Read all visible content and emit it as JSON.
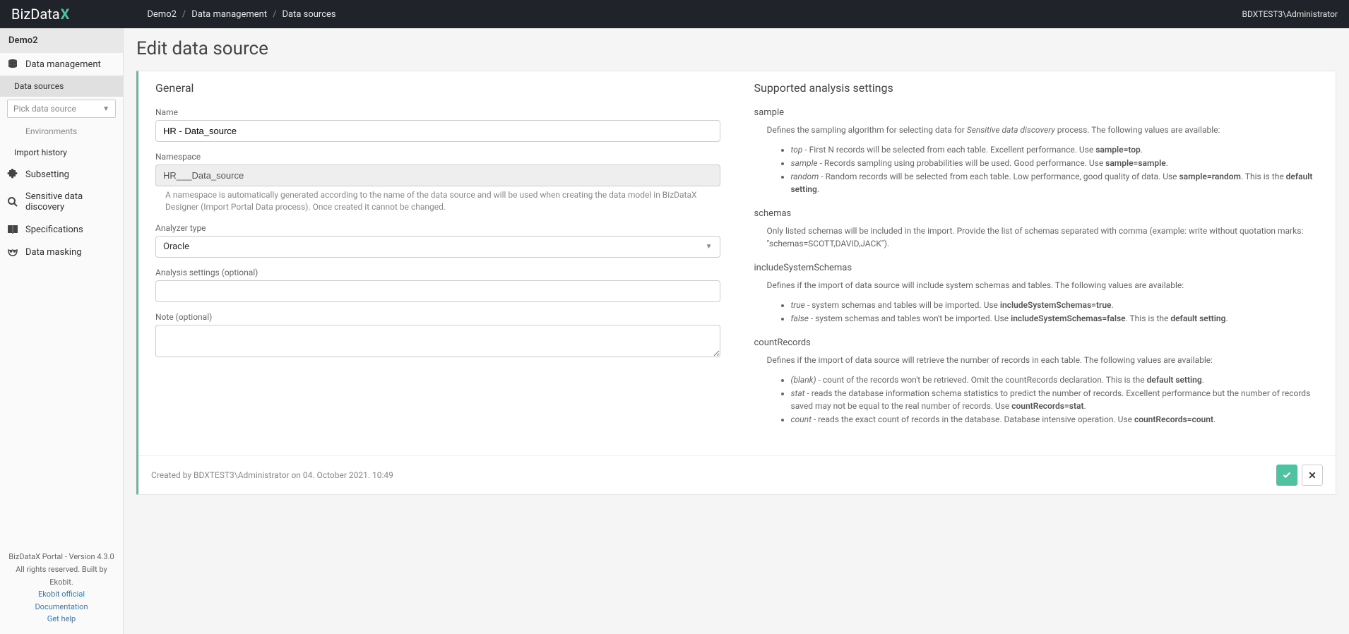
{
  "header": {
    "logo_text": "BizData",
    "logo_accent": "X",
    "breadcrumb": [
      "Demo2",
      "Data management",
      "Data sources"
    ],
    "user": "BDXTEST3\\Administrator"
  },
  "sidebar": {
    "title": "Demo2",
    "items": [
      {
        "label": "Data management",
        "icon": "database-icon"
      },
      {
        "label": "Subsetting",
        "icon": "puzzle-icon"
      },
      {
        "label": "Sensitive data discovery",
        "icon": "search-icon"
      },
      {
        "label": "Specifications",
        "icon": "book-icon"
      },
      {
        "label": "Data masking",
        "icon": "mask-icon"
      }
    ],
    "subitems": {
      "data_sources": "Data sources",
      "pick_placeholder": "Pick data source",
      "environments": "Environments",
      "import_history": "Import history"
    },
    "footer": {
      "version": "BizDataX Portal - Version 4.3.0",
      "rights": "All rights reserved. Built by Ekobit.",
      "links": [
        "Ekobit official",
        "Documentation",
        "Get help"
      ]
    }
  },
  "page": {
    "title": "Edit data source",
    "general": {
      "heading": "General",
      "name_label": "Name",
      "name_value": "HR - Data_source",
      "namespace_label": "Namespace",
      "namespace_value": "HR___Data_source",
      "namespace_help": "A namespace is automatically generated according to the name of the data source and will be used when creating the data model in BizDataX Designer (Import Portal Data process). Once created it cannot be changed.",
      "analyzer_label": "Analyzer type",
      "analyzer_value": "Oracle",
      "analysis_label": "Analysis settings (optional)",
      "analysis_value": "",
      "note_label": "Note (optional)",
      "note_value": ""
    },
    "settings": {
      "heading": "Supported analysis settings",
      "sample": {
        "key": "sample",
        "desc_prefix": "Defines the sampling algorithm for selecting data for ",
        "desc_em": "Sensitive data discovery",
        "desc_suffix": " process. The following values are available:",
        "items": [
          {
            "em": "top",
            "text": " - First N records will be selected from each table. Excellent performance. Use ",
            "b": "sample=top",
            "tail": "."
          },
          {
            "em": "sample",
            "text": " - Records sampling using probabilities will be used. Good performance. Use ",
            "b": "sample=sample",
            "tail": "."
          },
          {
            "em": "random",
            "text": " - Random records will be selected from each table. Low performance, good quality of data. Use ",
            "b": "sample=random",
            "tail": ". This is the ",
            "b2": "default setting",
            "tail2": "."
          }
        ]
      },
      "schemas": {
        "key": "schemas",
        "desc": "Only listed schemas will be included in the import. Provide the list of schemas separated with comma (example: write without quotation marks: \"schemas=SCOTT,DAVID,JACK\")."
      },
      "includeSystemSchemas": {
        "key": "includeSystemSchemas",
        "desc": "Defines if the import of data source will include system schemas and tables. The following values are available:",
        "items": [
          {
            "em": "true",
            "text": " - system schemas and tables will be imported. Use ",
            "b": "includeSystemSchemas=true",
            "tail": "."
          },
          {
            "em": "false",
            "text": " - system schemas and tables won't be imported. Use ",
            "b": "includeSystemSchemas=false",
            "tail": ". This is the ",
            "b2": "default setting",
            "tail2": "."
          }
        ]
      },
      "countRecords": {
        "key": "countRecords",
        "desc": "Defines if the import of data source will retrieve the number of records in each table. The following values are available:",
        "items": [
          {
            "em": "(blank)",
            "text": " - count of the records won't be retrieved. Omit the countRecords declaration. This is the ",
            "b": "default setting",
            "tail": "."
          },
          {
            "em": "stat",
            "text": " - reads the database information schema statistics to predict the number of records. Excellent performance but the number of records saved may not be equal to the real number of records. Use ",
            "b": "countRecords=stat",
            "tail": "."
          },
          {
            "em": "count",
            "text": " - reads the exact count of records in the database. Database intensive operation. Use ",
            "b": "countRecords=count",
            "tail": "."
          }
        ]
      }
    },
    "footer_text": "Created by BDXTEST3\\Administrator on 04. October 2021. 10:49"
  }
}
